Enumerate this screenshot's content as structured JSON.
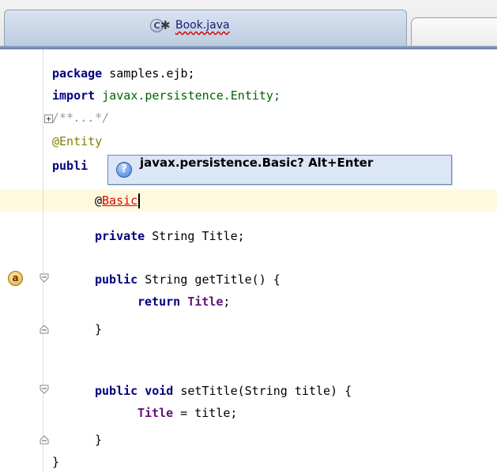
{
  "tab": {
    "file_icon": "class-file-icon",
    "file_icon_letter": "C",
    "modified_marker": "✱",
    "label": "Book.java"
  },
  "editor": {
    "lines": [
      {
        "kw": "package",
        "rest": " samples.ejb;"
      },
      {
        "kw": "import",
        "rest": " javax.persistence.Entity;"
      },
      {
        "comment": "/**...*/"
      },
      {
        "annotation": "@Entity"
      },
      {
        "kw_fragment": "publi"
      },
      {
        "at": "@",
        "typed": "Basic"
      },
      {
        "kw": "private",
        "rest": " String Title;"
      },
      {
        "kw": "public",
        "rest": " String getTitle() {"
      },
      {
        "kw": "return",
        "field": "Title",
        "rest": ";"
      },
      {
        "text": "}"
      },
      {
        "kw1": "public",
        "kw2": "void",
        "rest": " setTitle(String title) {"
      },
      {
        "field": "Title",
        "rest": " = title;"
      },
      {
        "text": "}"
      },
      {
        "text": "}"
      }
    ],
    "implements_badge": "a",
    "expand_glyph": "+"
  },
  "hint_popup": {
    "icon": "question-icon",
    "icon_glyph": "?",
    "text": "javax.persistence.Basic? Alt+Enter"
  },
  "colors": {
    "keyword": "#000080",
    "field": "#660e7a",
    "error": "#e00000",
    "current_line": "#fffadd",
    "popup_bg": "#dbe6f7"
  }
}
